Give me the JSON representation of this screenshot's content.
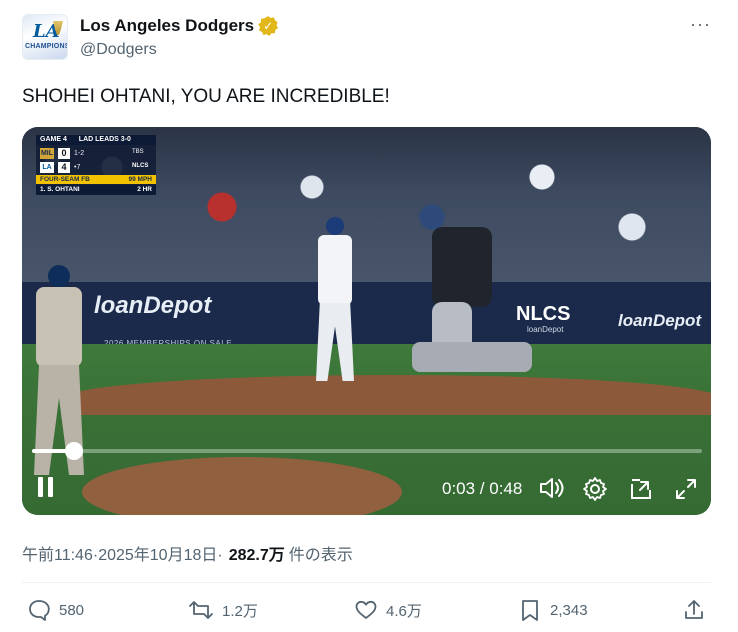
{
  "author": {
    "display_name": "Los Angeles Dodgers",
    "handle": "@Dodgers",
    "verified_icon": "gold-verified-badge",
    "avatar_logo_text": "LA",
    "avatar_caption": "CHAMPIONS"
  },
  "more_menu_label": "···",
  "tweet": {
    "text": "SHOHEI OHTANI, YOU ARE INCREDIBLE!"
  },
  "video": {
    "scorebug": {
      "game": "GAME 4",
      "series": "LAD LEADS 3-0",
      "away_team": "MIL",
      "away_score": "0",
      "home_team": "LA",
      "home_score": "4",
      "count": "1-2",
      "outs": "•7",
      "network": "TBS",
      "series_label": "NLCS",
      "pitch_type": "FOUR-SEAM FB",
      "pitch_speed": "99 MPH",
      "batter_line": "1. S. OHTANI",
      "batter_stat": "2 HR"
    },
    "wall_ads": [
      "loanDepot",
      "loanDepot"
    ],
    "wall_subtext": "2026 MEMBERSHIPS ON SALE",
    "nlcs_sign": "NLCS",
    "nlcs_sign_sub": "loanDepot",
    "current_time": "0:03",
    "duration": "0:48",
    "timecode_text": "0:03 / 0:48",
    "progress_fraction": 0.0625
  },
  "meta": {
    "time": "午前11:46",
    "separator": " · ",
    "date": "2025年10月18日",
    "separator2": " · ",
    "views": "282.7万",
    "views_label": "件の表示"
  },
  "actions": {
    "replies": "580",
    "reposts": "1.2万",
    "likes": "4.6万",
    "bookmarks": "2,343"
  }
}
